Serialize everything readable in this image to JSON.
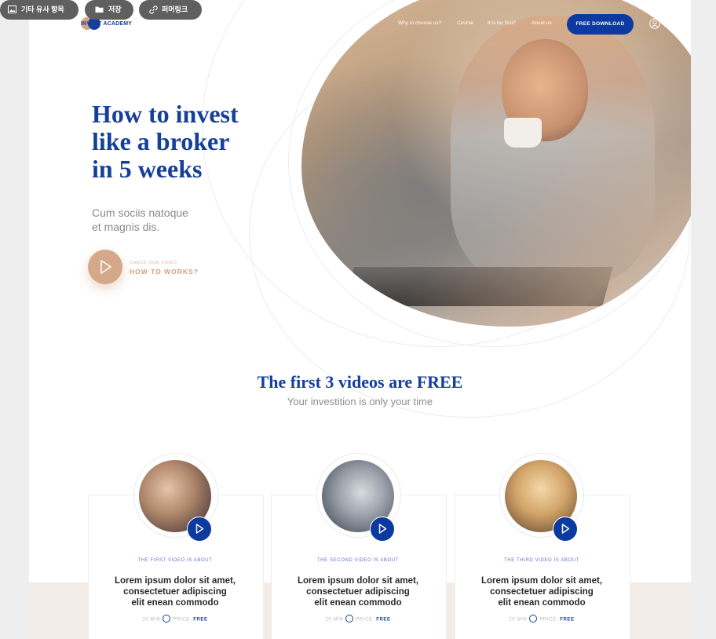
{
  "header": {
    "brand": "INVEST ACADEMY",
    "nav": [
      "Why to choose us?",
      "Course",
      "It is for You?",
      "About us"
    ],
    "download_label": "FREE DOWNLOAD",
    "login_label": "Login"
  },
  "hero": {
    "title_line1": "How to invest",
    "title_line2": "like a broker",
    "title_line3": "in 5 weeks",
    "subtitle_line1": "Cum sociis natoque",
    "subtitle_line2": "et magnis dis.",
    "video_eyebrow": "CHECK OUR VIDEO",
    "video_cta": "HOW TO WORKS?"
  },
  "section": {
    "title": "The first 3 videos are FREE",
    "subtitle": "Your investition is only your time"
  },
  "cards": [
    {
      "eyebrow": "THE FIRST VIDEO IS ABOUT",
      "title_line1": "Lorem ipsum dolor sit amet,",
      "title_line2": "consectetuer adipiscing",
      "title_line3": "elit enean commodo",
      "duration": "20 MIN",
      "price_label": "PRICE:",
      "price": "FREE"
    },
    {
      "eyebrow": "THE SECOND VIDEO IS ABOUT",
      "title_line1": "Lorem ipsum dolor sit amet,",
      "title_line2": "consectetuer adipiscing",
      "title_line3": "elit enean commodo",
      "duration": "20 MIN",
      "price_label": "PRICE:",
      "price": "FREE"
    },
    {
      "eyebrow": "THE THIRD VIDEO IS ABOUT",
      "title_line1": "Lorem ipsum dolor sit amet,",
      "title_line2": "consectetuer adipiscing",
      "title_line3": "elit enean commodo",
      "duration": "20 MIN",
      "price_label": "PRICE:",
      "price": "FREE"
    }
  ],
  "viewer_toolbar": {
    "similar_label": "기타 유사 항목",
    "save_label": "저장",
    "permalink_label": "퍼머링크"
  },
  "colors": {
    "brand_blue": "#163f9a",
    "accent_tan": "#d4a888",
    "beige_band": "#f3ece6"
  }
}
